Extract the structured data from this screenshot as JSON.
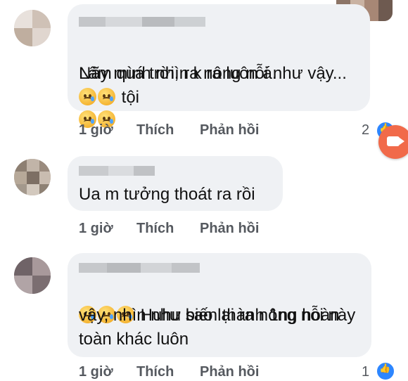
{
  "comments": [
    {
      "text_line1": "Nãy mình nhìn k ra luôn á.",
      "text_line1_after": " tội",
      "text_line2": "Lâm quá trời,  ra nông nỗi như vậy...",
      "time": "1 giờ",
      "like_label": "Thích",
      "reply_label": "Phản hồi",
      "reaction_count": "2"
    },
    {
      "text_line1": "Ua m tưởng thoát ra rồi",
      "time": "1 giờ",
      "like_label": "Thích",
      "reply_label": "Phản hồi"
    },
    {
      "text_line1_after": " Huhu sao lại ra nông nỗi này",
      "text_line2": "vậy, nhìn như biến thành 1ng hoàn",
      "text_line3": "toàn khác luôn",
      "time": "1 giờ",
      "like_label": "Thích",
      "reply_label": "Phản hồi",
      "reaction_count": "1"
    }
  ],
  "icons": {
    "emoji": "sad-face-tear-icon",
    "reaction": "like-thumb-icon",
    "overlay": "video-camera-icon"
  },
  "colors": {
    "bubble": "#eff1f4",
    "text": "#111111",
    "meta": "#55595f",
    "like_badge": "#2d86ff",
    "overlay_button": "#f16a4a"
  }
}
